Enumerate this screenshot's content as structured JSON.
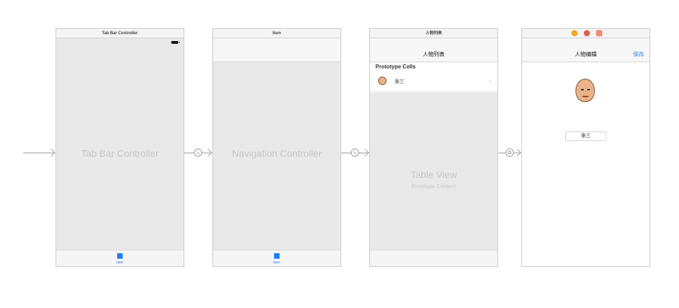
{
  "scenes": {
    "tab_bar_controller": {
      "title": "Tab Bar Controller",
      "center_label": "Tab Bar Controller",
      "tab_item_label": "Item"
    },
    "navigation_controller": {
      "title": "Item",
      "center_label": "Navigation Controller",
      "tab_item_label": "Item"
    },
    "table_view_controller": {
      "title": "人物列表",
      "nav_title": "人物列表",
      "section_header": "Prototype Cells",
      "cell_label": "张三",
      "table_view_label": "Table View",
      "table_view_sublabel": "Prototype Content"
    },
    "edit_view_controller": {
      "nav_title": "人物编辑",
      "save_button": "保存",
      "name_field_value": "张三"
    }
  },
  "icons": [
    "entry-arrow-icon",
    "relationship-segue-icon",
    "show-segue-icon",
    "battery-icon",
    "tab-item-icon",
    "avatar-icon",
    "disclosure-chevron-icon"
  ],
  "colors": {
    "accent": "#1a7ff5",
    "scene_bg": "#e9e9e9",
    "placeholder_text": "#c6c6c6",
    "segue_line": "#9a9a9a",
    "dot_first_responder": "#f5a623",
    "dot_exit": "#e05a4a",
    "dot_view_controller": "#f08a70"
  }
}
